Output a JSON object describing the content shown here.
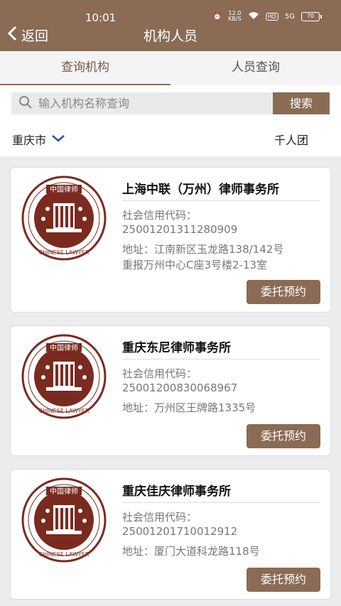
{
  "status_bar": {
    "time": "10:01",
    "speed_value": "12.0",
    "speed_unit": "KB/S",
    "hd": "HD",
    "signal": "5G",
    "battery": "70"
  },
  "nav": {
    "back_label": "返回",
    "title": "机构人员"
  },
  "tabs": [
    {
      "label": "查询机构"
    },
    {
      "label": "人员查询"
    }
  ],
  "search": {
    "placeholder": "输入机构名称查询",
    "value": "",
    "button_label": "搜索"
  },
  "filter": {
    "city": "重庆市",
    "group": "千人团"
  },
  "logo_text": {
    "top": "中国律师",
    "ring": "CHINESE LAWYER"
  },
  "colors": {
    "brand": "#8a6b54",
    "logo_red": "#7b2a1f"
  },
  "firms": [
    {
      "name": "上海中联（万州）律师事务所",
      "credit_label": "社会信用代码：",
      "credit_code": "25001201311280909",
      "address_line1": "地址：江南新区玉龙路138/142号",
      "address_line2": "重报万州中心C座3号楼2-13室",
      "button": "委托预约"
    },
    {
      "name": "重庆东尼律师事务所",
      "credit_label": "社会信用代码：",
      "credit_code": "25001200830068967",
      "address_line1": "地址：万州区王牌路1335号",
      "address_line2": "",
      "button": "委托预约"
    },
    {
      "name": "重庆佳庆律师事务所",
      "credit_label": "社会信用代码：",
      "credit_code": "25001201710012912",
      "address_line1": "地址：厦门大道科龙路118号",
      "address_line2": "",
      "button": "委托预约"
    }
  ]
}
